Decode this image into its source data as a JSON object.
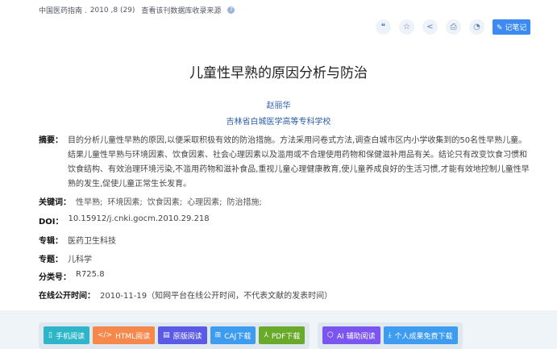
{
  "source": {
    "journal": "中国医药指南 .",
    "issue": "2010 ,8 (29)",
    "link": "查看该刊数据库收录来源"
  },
  "toolbar": {
    "icons": [
      "quote-icon",
      "star-icon",
      "share-icon",
      "print-icon",
      "bell-icon"
    ],
    "note_label": "记笔记"
  },
  "title": "儿童性早熟的原因分析与防治",
  "author": "赵丽华",
  "organization": "吉林省白城医学高等专科学校",
  "abstract": {
    "label": "摘要：",
    "text": "目的分析儿童性早熟的原因,以便采取积极有效的防治措施。方法采用问卷式方法,调查白城市区内小学收集到的50名性早熟儿童。结果儿童性早熟与环境因素、饮食因素、社会心理因素以及滥用或不合理使用药物和保健滋补用品有关。结论只有改变饮食习惯和饮食结构、有效治理环境污染,不滥用药物和滋补食品,重视儿童心理健康教育,使儿童养成良好的生活习惯,才能有效地控制儿童性早熟的发生,促使儿童正常生长发育。"
  },
  "keywords": {
    "label": "关键词：",
    "items": [
      "性早熟;",
      "环境因素;",
      "饮食因素;",
      "心理因素;",
      "防治措施;"
    ]
  },
  "doi": {
    "label": "DOI：",
    "value": "10.15912/j.cnki.gocm.2010.29.218"
  },
  "series": {
    "label": "专辑：",
    "value": "医药卫生科技"
  },
  "subject": {
    "label": "专题：",
    "value": "儿科学"
  },
  "classification": {
    "label": "分类号：",
    "value": "R725.8"
  },
  "published": {
    "label": "在线公开时间：",
    "value": "2010-11-19（知网平台在线公开时间，不代表文献的发表时间）"
  },
  "buttons": [
    {
      "label": "手机阅读",
      "icon": "phone-icon",
      "color": "#2eb5c9"
    },
    {
      "label": "HTML阅读",
      "icon": "code-icon",
      "color": "#f5884a"
    },
    {
      "label": "原版阅读",
      "icon": "book-icon",
      "color": "#5a5ae6"
    },
    {
      "label": "CAJ下载",
      "icon": "caj-icon",
      "color": "#3d9bf0"
    },
    {
      "label": "PDF下载",
      "icon": "pdf-icon",
      "color": "#6aaa2a"
    },
    {
      "label": "AI 辅助阅读",
      "icon": "ai-icon",
      "color": "#7a55f0"
    },
    {
      "label": "个人成果免费下载",
      "icon": "download-icon",
      "color": "#3d9bf0"
    }
  ]
}
